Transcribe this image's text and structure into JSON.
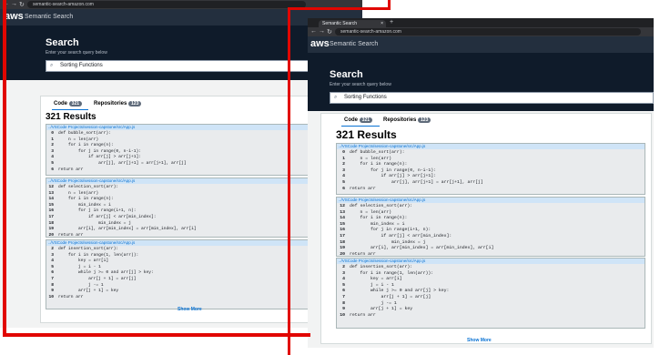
{
  "browser": {
    "tab_title": "Semantic Search",
    "url": "semantic-search-amazon.com",
    "new_tab_symbol": "+",
    "close_symbol": "×"
  },
  "header": {
    "logo": "aws",
    "title": "Semantic Search"
  },
  "search": {
    "title": "Search",
    "subtitle": "Enter your search query below",
    "query": "Sorting Functions"
  },
  "tabs": [
    {
      "label": "Code",
      "count": "321"
    },
    {
      "label": "Repositories",
      "count": "123"
    }
  ],
  "results_title": "321 Results",
  "results": [
    {
      "path": "../VSCode Projects/session-capstone/src/App.js",
      "lines": [
        {
          "n": "0",
          "code": "def bubble_sort(arr):"
        },
        {
          "n": "1",
          "code": "    n = len(arr)"
        },
        {
          "n": "2",
          "code": "    for i in range(n):"
        },
        {
          "n": "3",
          "code": "        for j in range(0, n-i-1):"
        },
        {
          "n": "4",
          "code": "            if arr[j] > arr[j+1]:"
        },
        {
          "n": "5",
          "code": "                arr[j], arr[j+1] = arr[j+1], arr[j]"
        },
        {
          "n": "6",
          "code": "return arr"
        }
      ]
    },
    {
      "path": "../VSCode Projects/session-capstone/src/App.js",
      "lines": [
        {
          "n": "12",
          "code": "def selection_sort(arr):"
        },
        {
          "n": "13",
          "code": "    n = len(arr)"
        },
        {
          "n": "14",
          "code": "    for i in range(n):"
        },
        {
          "n": "15",
          "code": "        min_index = i"
        },
        {
          "n": "16",
          "code": "        for j in range(i+1, n):"
        },
        {
          "n": "17",
          "code": "            if arr[j] < arr[min_index]:"
        },
        {
          "n": "18",
          "code": "                min_index = j"
        },
        {
          "n": "19",
          "code": "        arr[i], arr[min_index] = arr[min_index], arr[i]"
        },
        {
          "n": "20",
          "code": "return arr"
        }
      ]
    },
    {
      "path": "../VSCode Projects/session-capstone/src/App.js",
      "lines": [
        {
          "n": "2",
          "code": "def insertion_sort(arr):"
        },
        {
          "n": "3",
          "code": "    for i in range(1, len(arr)):"
        },
        {
          "n": "4",
          "code": "        key = arr[i]"
        },
        {
          "n": "5",
          "code": "        j = i - 1"
        },
        {
          "n": "6",
          "code": "        while j >= 0 and arr[j] > key:"
        },
        {
          "n": "7",
          "code": "            arr[j + 1] = arr[j]"
        },
        {
          "n": "8",
          "code": "            j -= 1"
        },
        {
          "n": "9",
          "code": "        arr[j + 1] = key"
        },
        {
          "n": "10",
          "code": "return arr"
        }
      ]
    }
  ],
  "show_more": "Show More"
}
